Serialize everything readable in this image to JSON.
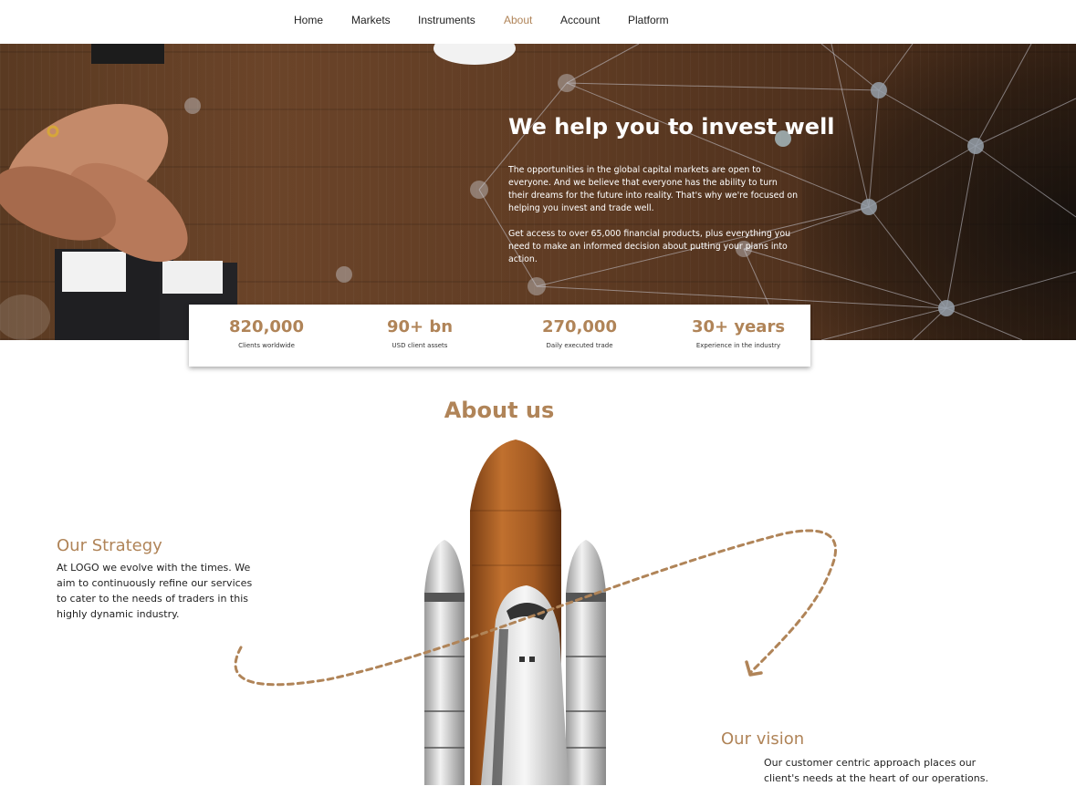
{
  "nav": {
    "items": [
      {
        "label": "Home"
      },
      {
        "label": "Markets"
      },
      {
        "label": "Instruments"
      },
      {
        "label": "About",
        "active": true
      },
      {
        "label": "Account"
      },
      {
        "label": "Platform"
      }
    ]
  },
  "hero": {
    "title": "We help you to invest well",
    "paragraph1": "The opportunities in the global capital markets are open to everyone. And we believe that everyone has the ability to turn their dreams for the future into reality. That's why we're focused on helping you invest and trade well.",
    "paragraph2": "Get access to over 65,000 financial products, plus everything you need to make an informed decision about putting your plans into action."
  },
  "stats": [
    {
      "value": "820,000",
      "label": "Clients worldwide"
    },
    {
      "value": "90+ bn",
      "label": "USD client assets"
    },
    {
      "value": "270,000",
      "label": "Daily executed trade"
    },
    {
      "value": "30+ years",
      "label": "Experience in the industry"
    }
  ],
  "about": {
    "title": "About us",
    "strategy": {
      "heading": "Our Strategy",
      "text": "At LOGO we evolve with the times. We aim to continuously refine our services to cater to the needs of traders in this highly dynamic industry."
    },
    "vision": {
      "heading": "Our vision",
      "text": "Our customer centric approach places our client's needs at the heart of our operations."
    }
  },
  "colors": {
    "accent": "#b08458",
    "text": "#222222",
    "hero_wood": "#6b4429"
  },
  "icons": [
    "rocket-illustration",
    "dashed-arrow-icon",
    "network-graphic"
  ]
}
